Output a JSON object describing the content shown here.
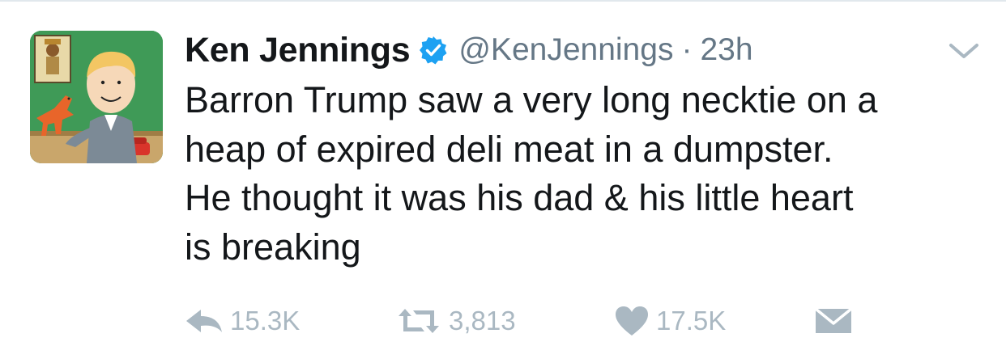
{
  "tweet": {
    "author_name": "Ken Jennings",
    "handle": "@KenJennings",
    "separator": "·",
    "time": "23h",
    "text": "Barron Trump saw a very long necktie on a\nheap of expired deli meat in a dumpster.\nHe thought it was his dad & his little heart\nis breaking",
    "verified": true
  },
  "actions": {
    "replies": "15.3K",
    "retweets": "3,813",
    "likes": "17.5K"
  },
  "icons": [
    "avatar",
    "verified-badge-icon",
    "chevron-down-icon",
    "reply-icon",
    "retweet-icon",
    "heart-icon",
    "envelope-icon"
  ],
  "colors": {
    "text": "#14171a",
    "muted": "#657786",
    "action_gray": "#aab8c2",
    "verified_blue": "#1da1f2"
  }
}
